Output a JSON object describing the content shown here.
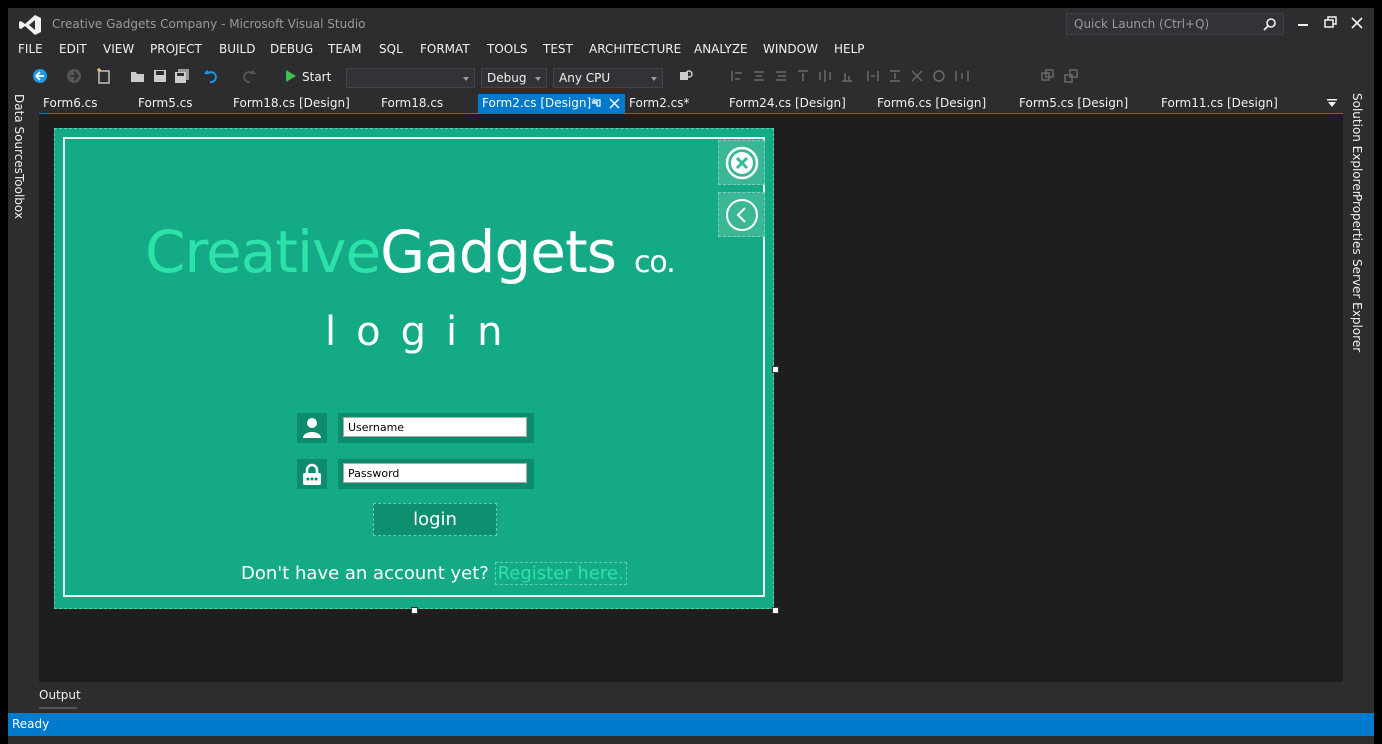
{
  "window": {
    "title": "Creative Gadgets Company - Microsoft Visual Studio",
    "quick_launch_placeholder": "Quick Launch (Ctrl+Q)"
  },
  "menu": [
    "FILE",
    "EDIT",
    "VIEW",
    "PROJECT",
    "BUILD",
    "DEBUG",
    "TEAM",
    "SQL",
    "FORMAT",
    "TOOLS",
    "TEST",
    "ARCHITECTURE",
    "ANALYZE",
    "WINDOW",
    "HELP"
  ],
  "toolbar": {
    "start_label": "Start",
    "config": "Debug",
    "platform": "Any CPU",
    "blank_combo": ""
  },
  "left_panels": [
    "Data Sources",
    "Toolbox"
  ],
  "right_panels": [
    "Solution Explorer",
    "Properties",
    "Server Explorer"
  ],
  "tabs": [
    {
      "label": "Form6.cs",
      "active": false
    },
    {
      "label": "Form5.cs",
      "active": false
    },
    {
      "label": "Form18.cs [Design]",
      "active": false
    },
    {
      "label": "Form18.cs",
      "active": false
    },
    {
      "label": "Form2.cs [Design]*",
      "active": true
    },
    {
      "label": "Form2.cs*",
      "active": false
    },
    {
      "label": "Form24.cs [Design]",
      "active": false
    },
    {
      "label": "Form6.cs [Design]",
      "active": false
    },
    {
      "label": "Form5.cs [Design]",
      "active": false
    },
    {
      "label": "Form11.cs [Design]",
      "active": false
    }
  ],
  "form": {
    "brand_part1": "Creative",
    "brand_part2": "Gadgets",
    "brand_part3": "co.",
    "heading": "login",
    "username_value": "Username",
    "password_value": "Password",
    "login_button": "login",
    "footer_prefix": "Don't have an account yet?",
    "footer_link": "Register here."
  },
  "bottom": {
    "output_tab": "Output",
    "status": "Ready"
  },
  "colors": {
    "form_bg": "#14aa85",
    "brand_accent": "#2de2a9",
    "accent": "#007acc",
    "ide_bg": "#2d2d30"
  }
}
